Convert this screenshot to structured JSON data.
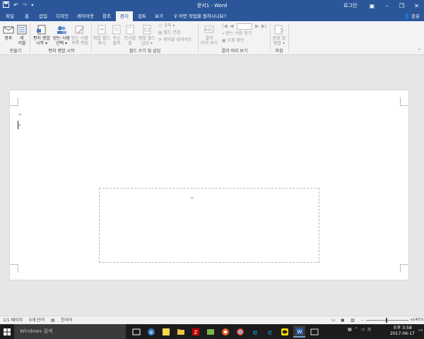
{
  "titlebar": {
    "title": "문서1 - Word",
    "login": "로그인",
    "qat": {
      "save_icon": "save-icon",
      "undo_icon": "undo-icon",
      "redo_icon": "redo-icon",
      "customize_icon": "chevron-down-icon"
    },
    "window_buttons": {
      "ribbon_options": "▣",
      "minimize": "–",
      "restore": "❐",
      "close": "✕"
    }
  },
  "tabs": [
    {
      "label": "파일",
      "active": false
    },
    {
      "label": "홈",
      "active": false
    },
    {
      "label": "삽입",
      "active": false
    },
    {
      "label": "디자인",
      "active": false
    },
    {
      "label": "레이아웃",
      "active": false
    },
    {
      "label": "참조",
      "active": false
    },
    {
      "label": "편지",
      "active": true
    },
    {
      "label": "검토",
      "active": false
    },
    {
      "label": "보기",
      "active": false
    }
  ],
  "tell_me": "어떤 작업을 원하시나요?",
  "share": "공유",
  "ribbon": {
    "create": {
      "envelopes": "봉투",
      "labels": "레\n이블",
      "group": "만들기"
    },
    "start": {
      "start_merge": "편지 병합\n시작 ▾",
      "select_recipients": "받는 사람\n선택 ▾",
      "edit_recipients": "받는 사람\n목록 편집",
      "group": "편지 병합 시작"
    },
    "fields": {
      "highlight": "병합 필드\n표시",
      "address_block": "주소\n블록",
      "greeting": "인사말\n줄",
      "insert_field": "병합 필드\n삽입 ▾",
      "rules": "규칙 ▾",
      "match_fields": "필드 연결",
      "update_labels": "레이블 업데이트",
      "group": "필드 쓰기 및 삽입"
    },
    "preview": {
      "preview_results": "결과\n미리 보기",
      "find_recipient": "받는 사람 찾기",
      "check_errors": "오류 확인",
      "record_value": "",
      "group": "결과 미리 보기"
    },
    "finish": {
      "finish_merge": "완료 및\n병합 ▾",
      "group": "마침"
    }
  },
  "document": {
    "para_mark": "↵"
  },
  "statusbar": {
    "page": "1/1 페이지",
    "words": "0개 단어",
    "language": "한국어",
    "zoom": "145%",
    "zoom_level_percent": 145
  },
  "taskbar": {
    "search_placeholder": "Windows 검색",
    "ime": "가",
    "time": "오후 3:58",
    "date": "2017-06-17"
  },
  "colors": {
    "word_blue": "#2b579a",
    "ribbon_bg": "#f3f3f3",
    "taskbar_bg": "#1c1c1c"
  }
}
